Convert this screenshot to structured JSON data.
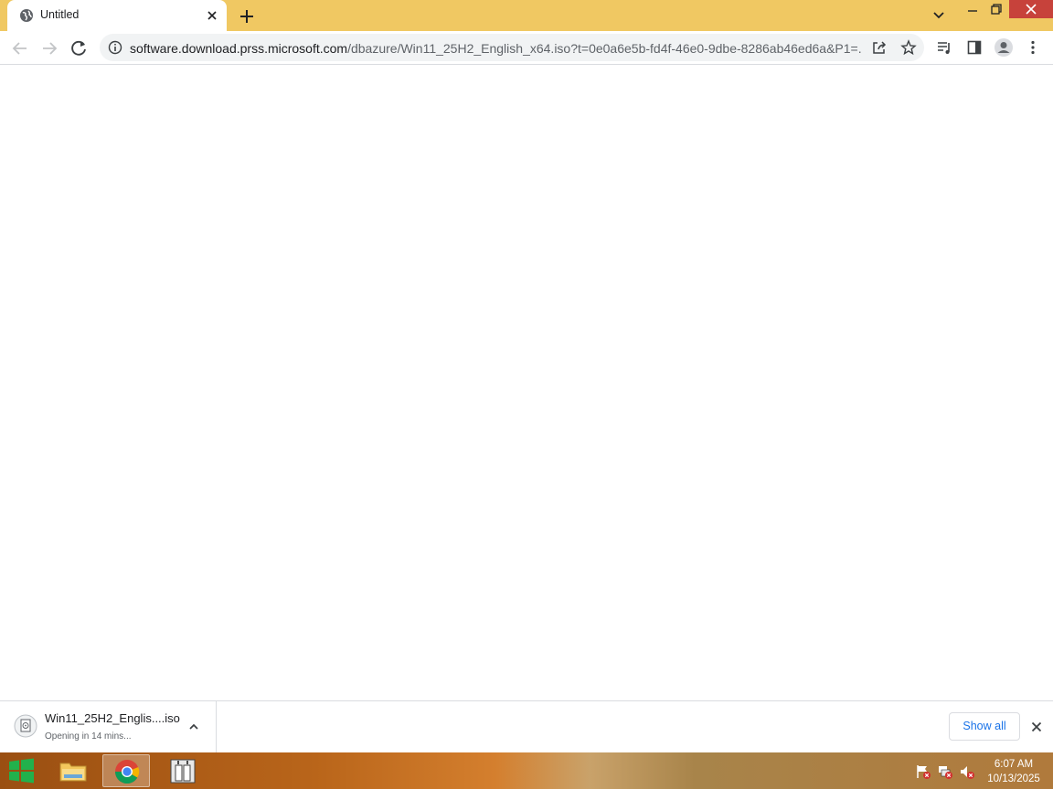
{
  "browser": {
    "tab": {
      "title": "Untitled",
      "favicon": "globe-icon"
    },
    "omnibox": {
      "url_host": "software.download.prss.microsoft.com",
      "url_path": "/dbazure/Win11_25H2_English_x64.iso?t=0e0a6e5b-fd4f-46e0-9dbe-8286ab46ed6a&P1=..."
    },
    "theme": {
      "tabstrip": "#f0c862",
      "close_button": "#c7423b"
    }
  },
  "download_shelf": {
    "item": {
      "name": "Win11_25H2_Englis....iso",
      "status": "Opening in 14 mins..."
    },
    "show_all_label": "Show all"
  },
  "taskbar": {
    "apps": [
      "file-explorer-icon",
      "chrome-icon",
      "secondary-app-icon"
    ],
    "clock": {
      "time": "6:07 AM",
      "date": "10/13/2025"
    }
  }
}
